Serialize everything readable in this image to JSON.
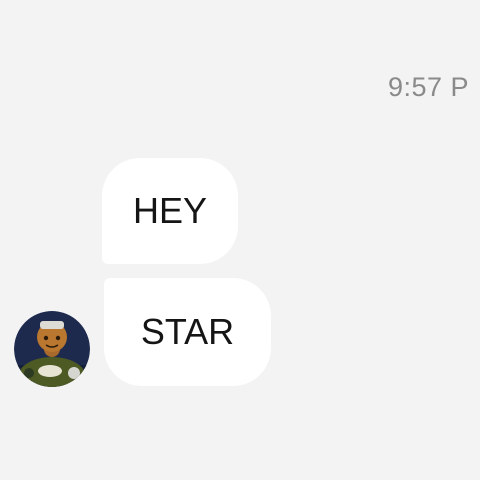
{
  "chat": {
    "timestamp": "9:57 P",
    "messages": [
      {
        "text": "HEY"
      },
      {
        "text": "STAR"
      }
    ],
    "avatar_icon": "cartoon-character-avatar"
  },
  "colors": {
    "background": "#f3f3f3",
    "bubble": "#ffffff",
    "message_text": "#151515",
    "timestamp_text": "#8a8a8a",
    "avatar_background": "#1d2a4e"
  }
}
